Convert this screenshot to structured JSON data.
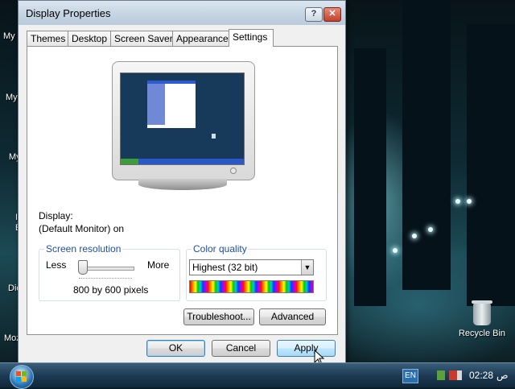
{
  "desktop": {
    "left_labels": [
      "My",
      "My",
      "My",
      "I",
      "E",
      "Dic",
      "Moz"
    ],
    "recycle_bin_label": "Recycle Bin"
  },
  "dialog": {
    "title": "Display Properties",
    "help_glyph": "?",
    "close_glyph": "✕",
    "tabs": [
      {
        "label": "Themes"
      },
      {
        "label": "Desktop"
      },
      {
        "label": "Screen Saver"
      },
      {
        "label": "Appearance"
      },
      {
        "label": "Settings",
        "active": true
      }
    ],
    "display_label": "Display:",
    "display_value": "(Default Monitor) on",
    "screen_resolution": {
      "title": "Screen resolution",
      "less": "Less",
      "more": "More",
      "value": "800 by 600 pixels",
      "slider_position": 0.0
    },
    "color_quality": {
      "title": "Color quality",
      "selected": "Highest (32 bit)"
    },
    "buttons": {
      "troubleshoot": "Troubleshoot...",
      "advanced": "Advanced",
      "ok": "OK",
      "cancel": "Cancel",
      "apply": "Apply"
    }
  },
  "taskbar": {
    "language": "EN",
    "clock": "02:28",
    "am_pm": "ص"
  },
  "colors": {
    "accent": "#1f4fa8",
    "taskbar": "#1d3b54",
    "close_button": "#c2412b"
  }
}
